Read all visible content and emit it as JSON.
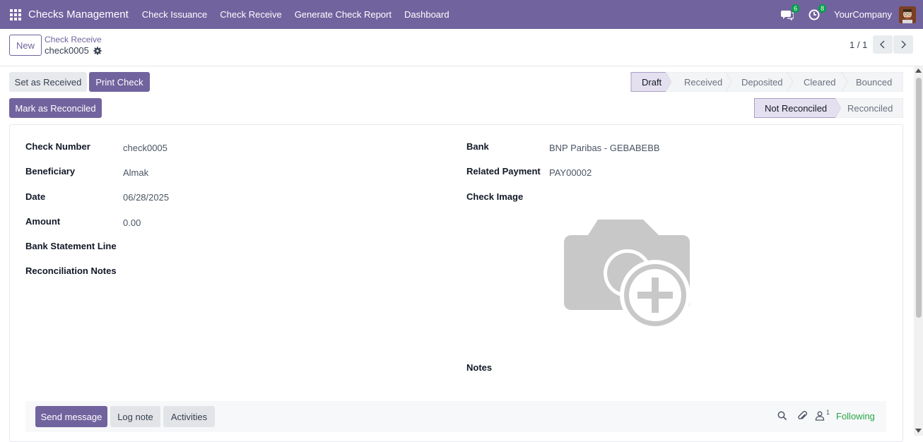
{
  "navbar": {
    "app_title": "Checks Management",
    "menu": [
      "Check Issuance",
      "Check Receive",
      "Generate Check Report",
      "Dashboard"
    ],
    "messages_count": "6",
    "activities_count": "8",
    "company": "YourCompany"
  },
  "control": {
    "new_label": "New",
    "breadcrumb_parent": "Check Receive",
    "breadcrumb_current": "check0005",
    "pager": "1 / 1"
  },
  "actions": {
    "set_received": "Set as Received",
    "print_check": "Print Check",
    "mark_reconciled": "Mark as Reconciled"
  },
  "status": {
    "stages": [
      "Draft",
      "Received",
      "Deposited",
      "Cleared",
      "Bounced"
    ],
    "active": "Draft",
    "reconcile_stages": [
      "Not Reconciled",
      "Reconciled"
    ],
    "reconcile_active": "Not Reconciled"
  },
  "form": {
    "check_number_label": "Check Number",
    "check_number": "check0005",
    "beneficiary_label": "Beneficiary",
    "beneficiary": "Almak",
    "date_label": "Date",
    "date": "06/28/2025",
    "amount_label": "Amount",
    "amount": "0.00",
    "bank_statement_label": "Bank Statement Line",
    "reconciliation_notes_label": "Reconciliation Notes",
    "bank_label": "Bank",
    "bank": "BNP Paribas - GEBABEBB",
    "related_payment_label": "Related Payment",
    "related_payment": "PAY00002",
    "check_image_label": "Check Image",
    "notes_label": "Notes"
  },
  "chatter": {
    "send_message": "Send message",
    "log_note": "Log note",
    "activities": "Activities",
    "followers_count": "1",
    "following": "Following"
  },
  "colors": {
    "brand": "#71639e",
    "following": "#28a745"
  }
}
